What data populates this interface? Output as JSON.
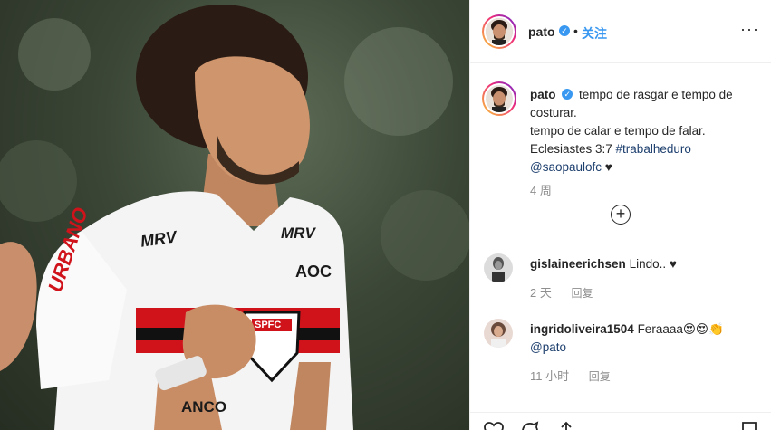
{
  "header": {
    "username": "pato",
    "verified_mark": "✓",
    "separator": "•",
    "follow_label": "关注",
    "more_label": "···"
  },
  "caption": {
    "username": "pato",
    "verified_mark": "✓",
    "line1": "tempo de rasgar e tempo de costurar.",
    "line2": "tempo de calar e tempo de falar.",
    "line3_text": "Eclesiastes 3:7 ",
    "line3_tag": "#trabalheduro",
    "mention": "@saopaulofc",
    "heart": "♥",
    "time": "4 周",
    "load_more": "+"
  },
  "comments": [
    {
      "username": "gislaineerichsen",
      "text": " Lindo.. ♥",
      "time": "2 天",
      "reply_label": "回复"
    },
    {
      "username": "ingridoliveira1504",
      "text": " Feraaaa😍😍👏",
      "mention": "@pato",
      "time": "11 小时",
      "reply_label": "回复"
    }
  ],
  "photo": {
    "jersey_sponsor_chest": "MRV",
    "jersey_sponsor_right": "MRV",
    "jersey_sleeve": "URBANO",
    "jersey_badge": "SPFC",
    "jersey_bottom": "ANCO",
    "jersey_shoulder": "AOC"
  },
  "colors": {
    "accent": "#3897f0",
    "text": "#262626",
    "muted": "#8e8e8e",
    "border": "#efefef",
    "jersey_red": "#d0121b"
  },
  "icons": {
    "like": "heart-icon",
    "comment": "comment-icon",
    "share": "share-icon",
    "save": "bookmark-icon",
    "more": "more-options-icon",
    "load_more": "plus-circle-icon"
  }
}
